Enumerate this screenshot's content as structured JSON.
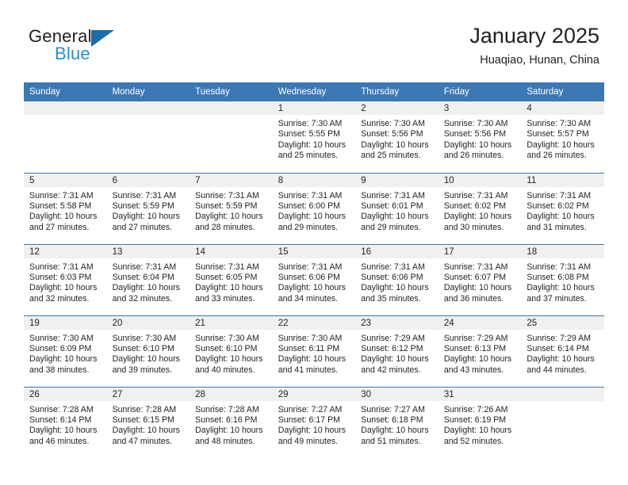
{
  "brand": {
    "line1": "General",
    "line2": "Blue",
    "triangle_color": "#1b6ca8",
    "blue_text_color": "#2e8bd0"
  },
  "header": {
    "title": "January 2025",
    "location": "Huaqiao, Hunan, China",
    "header_bg": "#3c78b4",
    "daynum_band_bg": "#f0f0f0"
  },
  "weekday_headers": [
    "Sunday",
    "Monday",
    "Tuesday",
    "Wednesday",
    "Thursday",
    "Friday",
    "Saturday"
  ],
  "weeks": [
    [
      {
        "day": "",
        "empty": true
      },
      {
        "day": "",
        "empty": true
      },
      {
        "day": "",
        "empty": true
      },
      {
        "day": "1",
        "sunrise": "Sunrise: 7:30 AM",
        "sunset": "Sunset: 5:55 PM",
        "daylight1": "Daylight: 10 hours",
        "daylight2": "and 25 minutes."
      },
      {
        "day": "2",
        "sunrise": "Sunrise: 7:30 AM",
        "sunset": "Sunset: 5:56 PM",
        "daylight1": "Daylight: 10 hours",
        "daylight2": "and 25 minutes."
      },
      {
        "day": "3",
        "sunrise": "Sunrise: 7:30 AM",
        "sunset": "Sunset: 5:56 PM",
        "daylight1": "Daylight: 10 hours",
        "daylight2": "and 26 minutes."
      },
      {
        "day": "4",
        "sunrise": "Sunrise: 7:30 AM",
        "sunset": "Sunset: 5:57 PM",
        "daylight1": "Daylight: 10 hours",
        "daylight2": "and 26 minutes."
      }
    ],
    [
      {
        "day": "5",
        "sunrise": "Sunrise: 7:31 AM",
        "sunset": "Sunset: 5:58 PM",
        "daylight1": "Daylight: 10 hours",
        "daylight2": "and 27 minutes."
      },
      {
        "day": "6",
        "sunrise": "Sunrise: 7:31 AM",
        "sunset": "Sunset: 5:59 PM",
        "daylight1": "Daylight: 10 hours",
        "daylight2": "and 27 minutes."
      },
      {
        "day": "7",
        "sunrise": "Sunrise: 7:31 AM",
        "sunset": "Sunset: 5:59 PM",
        "daylight1": "Daylight: 10 hours",
        "daylight2": "and 28 minutes."
      },
      {
        "day": "8",
        "sunrise": "Sunrise: 7:31 AM",
        "sunset": "Sunset: 6:00 PM",
        "daylight1": "Daylight: 10 hours",
        "daylight2": "and 29 minutes."
      },
      {
        "day": "9",
        "sunrise": "Sunrise: 7:31 AM",
        "sunset": "Sunset: 6:01 PM",
        "daylight1": "Daylight: 10 hours",
        "daylight2": "and 29 minutes."
      },
      {
        "day": "10",
        "sunrise": "Sunrise: 7:31 AM",
        "sunset": "Sunset: 6:02 PM",
        "daylight1": "Daylight: 10 hours",
        "daylight2": "and 30 minutes."
      },
      {
        "day": "11",
        "sunrise": "Sunrise: 7:31 AM",
        "sunset": "Sunset: 6:02 PM",
        "daylight1": "Daylight: 10 hours",
        "daylight2": "and 31 minutes."
      }
    ],
    [
      {
        "day": "12",
        "sunrise": "Sunrise: 7:31 AM",
        "sunset": "Sunset: 6:03 PM",
        "daylight1": "Daylight: 10 hours",
        "daylight2": "and 32 minutes."
      },
      {
        "day": "13",
        "sunrise": "Sunrise: 7:31 AM",
        "sunset": "Sunset: 6:04 PM",
        "daylight1": "Daylight: 10 hours",
        "daylight2": "and 32 minutes."
      },
      {
        "day": "14",
        "sunrise": "Sunrise: 7:31 AM",
        "sunset": "Sunset: 6:05 PM",
        "daylight1": "Daylight: 10 hours",
        "daylight2": "and 33 minutes."
      },
      {
        "day": "15",
        "sunrise": "Sunrise: 7:31 AM",
        "sunset": "Sunset: 6:06 PM",
        "daylight1": "Daylight: 10 hours",
        "daylight2": "and 34 minutes."
      },
      {
        "day": "16",
        "sunrise": "Sunrise: 7:31 AM",
        "sunset": "Sunset: 6:06 PM",
        "daylight1": "Daylight: 10 hours",
        "daylight2": "and 35 minutes."
      },
      {
        "day": "17",
        "sunrise": "Sunrise: 7:31 AM",
        "sunset": "Sunset: 6:07 PM",
        "daylight1": "Daylight: 10 hours",
        "daylight2": "and 36 minutes."
      },
      {
        "day": "18",
        "sunrise": "Sunrise: 7:31 AM",
        "sunset": "Sunset: 6:08 PM",
        "daylight1": "Daylight: 10 hours",
        "daylight2": "and 37 minutes."
      }
    ],
    [
      {
        "day": "19",
        "sunrise": "Sunrise: 7:30 AM",
        "sunset": "Sunset: 6:09 PM",
        "daylight1": "Daylight: 10 hours",
        "daylight2": "and 38 minutes."
      },
      {
        "day": "20",
        "sunrise": "Sunrise: 7:30 AM",
        "sunset": "Sunset: 6:10 PM",
        "daylight1": "Daylight: 10 hours",
        "daylight2": "and 39 minutes."
      },
      {
        "day": "21",
        "sunrise": "Sunrise: 7:30 AM",
        "sunset": "Sunset: 6:10 PM",
        "daylight1": "Daylight: 10 hours",
        "daylight2": "and 40 minutes."
      },
      {
        "day": "22",
        "sunrise": "Sunrise: 7:30 AM",
        "sunset": "Sunset: 6:11 PM",
        "daylight1": "Daylight: 10 hours",
        "daylight2": "and 41 minutes."
      },
      {
        "day": "23",
        "sunrise": "Sunrise: 7:29 AM",
        "sunset": "Sunset: 6:12 PM",
        "daylight1": "Daylight: 10 hours",
        "daylight2": "and 42 minutes."
      },
      {
        "day": "24",
        "sunrise": "Sunrise: 7:29 AM",
        "sunset": "Sunset: 6:13 PM",
        "daylight1": "Daylight: 10 hours",
        "daylight2": "and 43 minutes."
      },
      {
        "day": "25",
        "sunrise": "Sunrise: 7:29 AM",
        "sunset": "Sunset: 6:14 PM",
        "daylight1": "Daylight: 10 hours",
        "daylight2": "and 44 minutes."
      }
    ],
    [
      {
        "day": "26",
        "sunrise": "Sunrise: 7:28 AM",
        "sunset": "Sunset: 6:14 PM",
        "daylight1": "Daylight: 10 hours",
        "daylight2": "and 46 minutes."
      },
      {
        "day": "27",
        "sunrise": "Sunrise: 7:28 AM",
        "sunset": "Sunset: 6:15 PM",
        "daylight1": "Daylight: 10 hours",
        "daylight2": "and 47 minutes."
      },
      {
        "day": "28",
        "sunrise": "Sunrise: 7:28 AM",
        "sunset": "Sunset: 6:16 PM",
        "daylight1": "Daylight: 10 hours",
        "daylight2": "and 48 minutes."
      },
      {
        "day": "29",
        "sunrise": "Sunrise: 7:27 AM",
        "sunset": "Sunset: 6:17 PM",
        "daylight1": "Daylight: 10 hours",
        "daylight2": "and 49 minutes."
      },
      {
        "day": "30",
        "sunrise": "Sunrise: 7:27 AM",
        "sunset": "Sunset: 6:18 PM",
        "daylight1": "Daylight: 10 hours",
        "daylight2": "and 51 minutes."
      },
      {
        "day": "31",
        "sunrise": "Sunrise: 7:26 AM",
        "sunset": "Sunset: 6:19 PM",
        "daylight1": "Daylight: 10 hours",
        "daylight2": "and 52 minutes."
      },
      {
        "day": "",
        "empty": true
      }
    ]
  ]
}
